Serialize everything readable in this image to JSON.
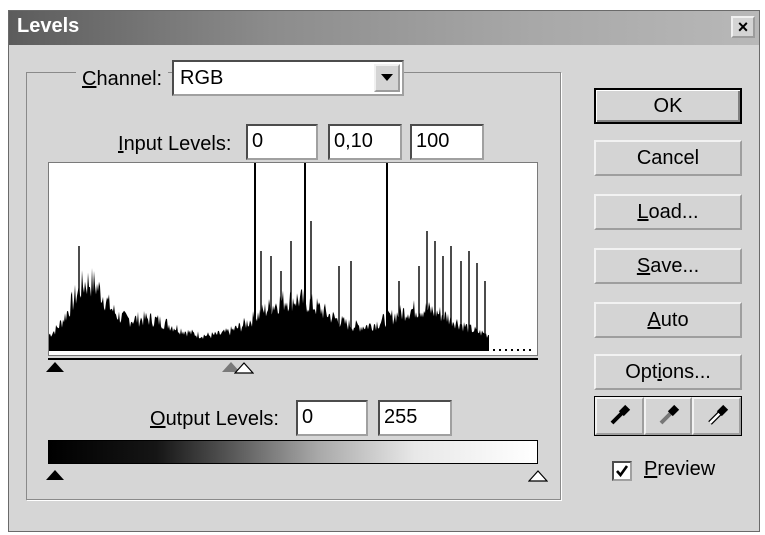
{
  "window": {
    "title": "Levels",
    "close_label": "×"
  },
  "channel": {
    "label_prefix": "",
    "label_underline": "C",
    "label_rest": "hannel:",
    "selected": "RGB"
  },
  "input_levels": {
    "label_underline": "I",
    "label_rest": "nput Levels:",
    "black": "0",
    "gamma": "0,10",
    "white": "100"
  },
  "output_levels": {
    "label_underline": "O",
    "label_rest": "utput Levels:",
    "black": "0",
    "white": "255"
  },
  "buttons": {
    "ok": "OK",
    "cancel": "Cancel",
    "load_underline": "L",
    "load_rest": "oad...",
    "save_underline": "S",
    "save_rest": "ave...",
    "auto_underline": "A",
    "auto_rest": "uto",
    "options_pre": "Opt",
    "options_underline": "i",
    "options_rest": "ons..."
  },
  "preview": {
    "label_underline": "P",
    "label_rest": "review",
    "checked": true
  },
  "icons": {
    "dropdown": "chevron-down-icon",
    "eyedroppers": [
      "black-eyedropper-icon",
      "gray-eyedropper-icon",
      "white-eyedropper-icon"
    ],
    "check": "checkmark-icon"
  },
  "colors": {
    "dialog_bg": "#d6d6d6",
    "titlebar_start": "#5c5c5c",
    "histogram_fill": "#000000"
  }
}
